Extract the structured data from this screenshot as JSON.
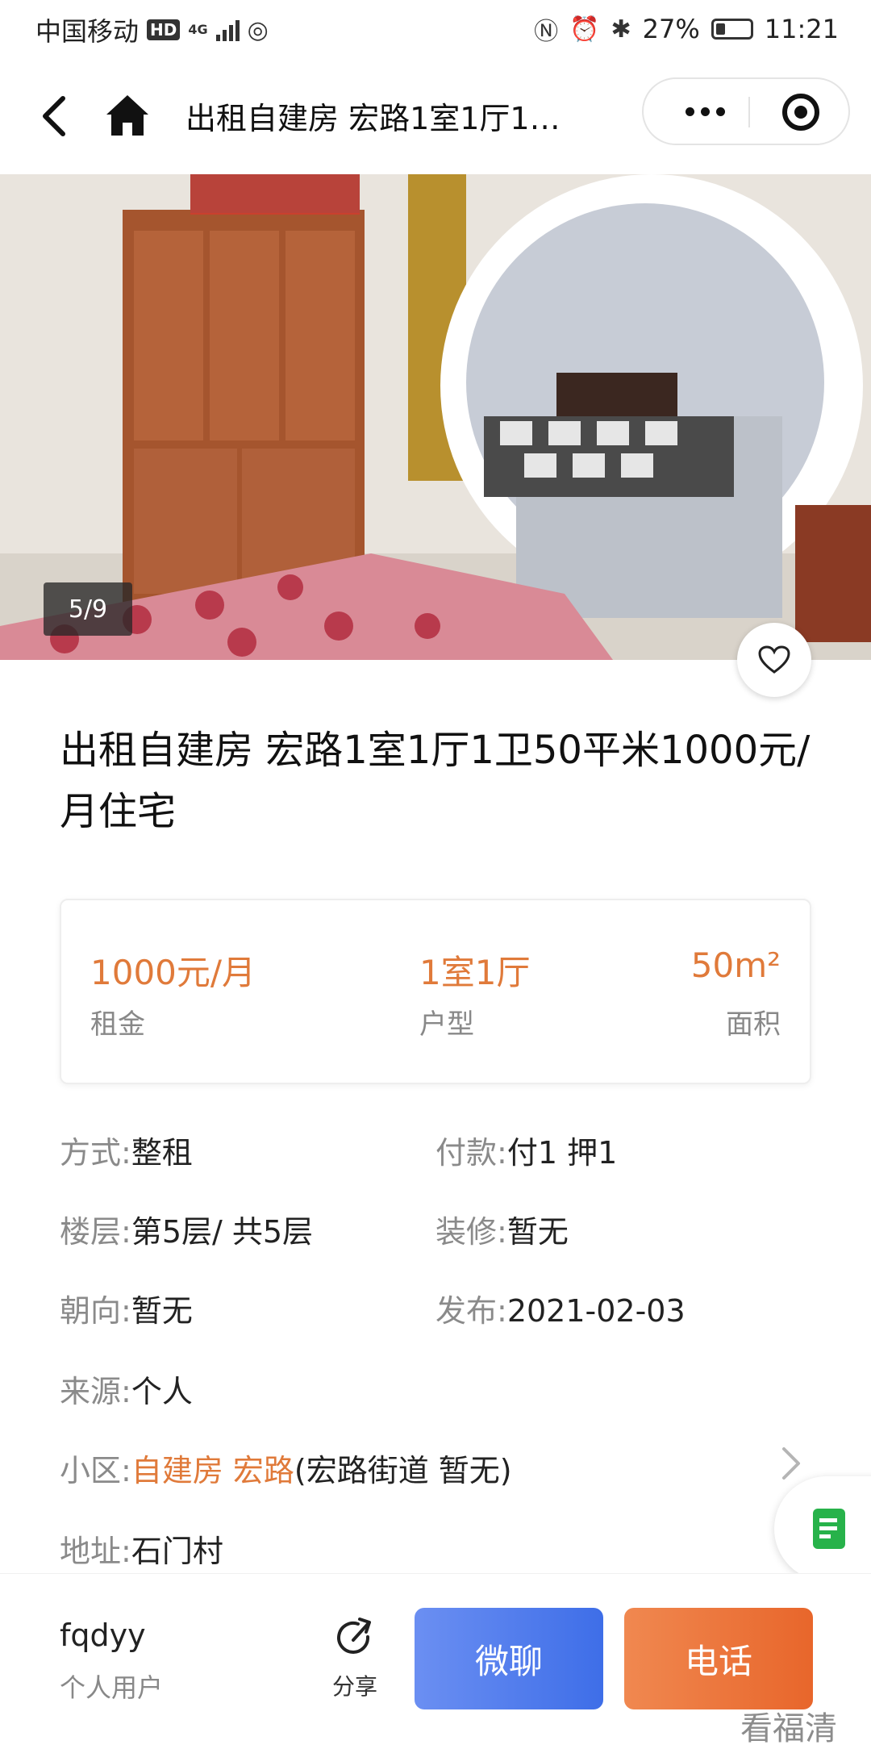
{
  "status_bar": {
    "carrier": "中国移动",
    "hd": "HD",
    "network": "4G",
    "battery": "27%",
    "time": "11:21"
  },
  "nav": {
    "title": "出租自建房  宏路1室1厅1…"
  },
  "gallery": {
    "counter": "5/9"
  },
  "listing": {
    "title": "出租自建房  宏路1室1厅1卫50平米1000元/月住宅"
  },
  "stats": [
    {
      "value": "1000元/月",
      "label": "租金"
    },
    {
      "value": "1室1厅",
      "label": "户型"
    },
    {
      "value": "50m²",
      "label": "面积"
    }
  ],
  "details": {
    "mode_label": "方式:",
    "mode": "整租",
    "payment_label": "付款:",
    "payment": "付1  押1",
    "floor_label": "楼层:",
    "floor": "第5层/  共5层",
    "decoration_label": "装修:",
    "decoration": "暂无",
    "orientation_label": "朝向:",
    "orientation": "暂无",
    "published_label": "发布:",
    "published": "2021-02-03",
    "source_label": "来源:",
    "source": "个人",
    "community_label": "小区:",
    "community": "自建房  宏路",
    "community_extra": "(宏路街道  暂无)",
    "address_label": "地址:",
    "address": "石门村"
  },
  "bottom": {
    "user_name": "fqdyy",
    "user_type": "个人用户",
    "share_label": "分享",
    "chat_label": "微聊",
    "call_label": "电话"
  },
  "watermark": "看福清",
  "colors": {
    "accent_orange": "#e07a3a",
    "chat_blue": "#4a78ec",
    "call_orange": "#ec6f33"
  },
  "icons": {
    "back": "chevron-left-icon",
    "home": "home-icon",
    "more": "more-dots-icon",
    "close": "target-close-icon",
    "favorite": "heart-icon",
    "share": "share-icon",
    "document": "document-icon"
  }
}
